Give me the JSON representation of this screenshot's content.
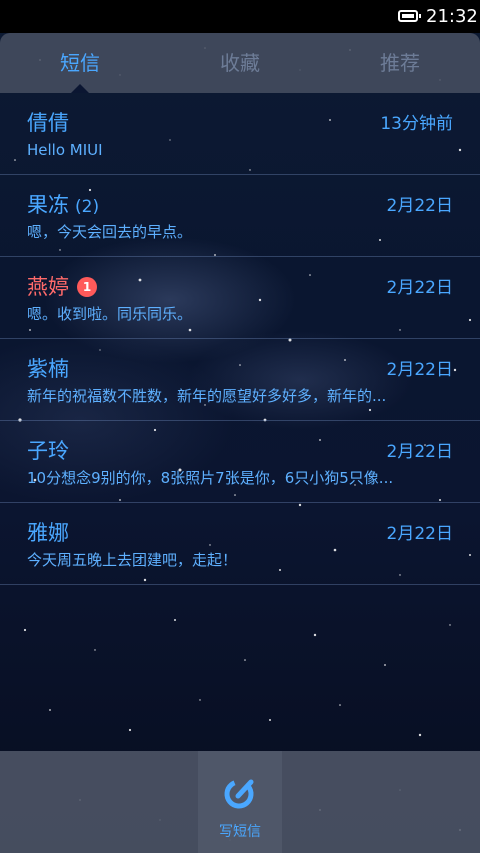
{
  "status_bar": {
    "time": "21:32",
    "battery_icon": "battery-icon"
  },
  "tabs": [
    {
      "label": "短信",
      "active": true
    },
    {
      "label": "收藏",
      "active": false
    },
    {
      "label": "推荐",
      "active": false
    }
  ],
  "messages": [
    {
      "name": "倩倩",
      "count": "",
      "badge": "",
      "date": "13分钟前",
      "preview": "Hello MIUI",
      "unread": false
    },
    {
      "name": "果冻",
      "count": "(2)",
      "badge": "",
      "date": "2月22日",
      "preview": "嗯，今天会回去的早点。",
      "unread": false
    },
    {
      "name": "燕婷",
      "count": "",
      "badge": "1",
      "date": "2月22日",
      "preview": "嗯。收到啦。同乐同乐。",
      "unread": true
    },
    {
      "name": "紫楠",
      "count": "",
      "badge": "",
      "date": "2月22日",
      "preview": "新年的祝福数不胜数，新年的愿望好多好多，新年的...",
      "unread": false
    },
    {
      "name": "子玲",
      "count": "",
      "badge": "",
      "date": "2月22日",
      "preview": "10分想念9别的你，8张照片7张是你，6只小狗5只像...",
      "unread": false
    },
    {
      "name": "雅娜",
      "count": "",
      "badge": "",
      "date": "2月22日",
      "preview": "今天周五晚上去团建吧，走起！",
      "unread": false
    }
  ],
  "bottom_bar": {
    "compose_label": "写短信",
    "compose_icon": "compose-icon"
  },
  "colors": {
    "accent": "#4aa7ff",
    "unread_name": "#ff6a6a",
    "badge": "#ff5a5a",
    "inactive_tab": "#6d7c97"
  }
}
